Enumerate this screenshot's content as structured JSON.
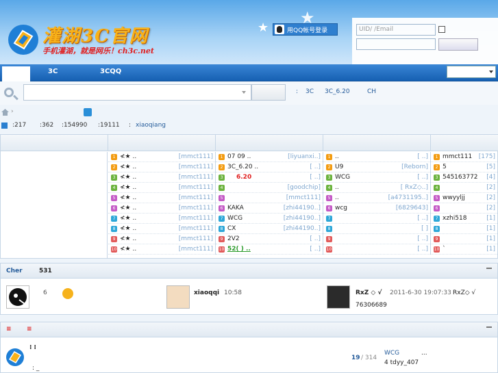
{
  "header": {
    "brand": "灌湖3C官网",
    "slogan": "手机灌湖，就是网乐！ch3c.net",
    "qq_login": "用QQ帐号登录",
    "uid_placeholder": "UID/  /Email",
    "colors": {
      "brand": "#f8b21a",
      "slogan": "#e02020",
      "sky": "#5aa8e8"
    }
  },
  "nav": {
    "items": [
      "3C",
      "3CQQ"
    ]
  },
  "search": {
    "hot": [
      ":",
      "3C",
      "3C_6.20",
      "CH"
    ]
  },
  "stats": {
    "items": [
      ":217",
      ":362",
      ":154990",
      ":19111",
      ":"
    ],
    "latest_member": "xiaoqiang"
  },
  "forum": {
    "col1": [
      {
        "n": "1",
        "t": "≮★",
        "dot": "..",
        "tag": "[mmct111]",
        "c": "#f39c12"
      },
      {
        "n": "2",
        "t": "≮★",
        "dot": "..",
        "tag": "[mmct111]",
        "c": "#f39c12"
      },
      {
        "n": "3",
        "t": "≮★",
        "dot": "..",
        "tag": "[mmct111]",
        "c": "#6cb33e"
      },
      {
        "n": "4",
        "t": "≮★",
        "dot": "..",
        "tag": "[mmct111]",
        "c": "#6cb33e"
      },
      {
        "n": "5",
        "t": "≮★",
        "dot": "..",
        "tag": "[mmct111]",
        "c": "#c45ac6"
      },
      {
        "n": "6",
        "t": "≮★",
        "dot": "..",
        "tag": "[mmct111]",
        "c": "#c45ac6"
      },
      {
        "n": "7",
        "t": "≮★",
        "dot": "..",
        "tag": "[mmct111]",
        "c": "#2ea7d8"
      },
      {
        "n": "8",
        "t": "≮★",
        "dot": "..",
        "tag": "[mmct111]",
        "c": "#2ea7d8"
      },
      {
        "n": "9",
        "t": "≮★",
        "dot": "..",
        "tag": "[mmct111]",
        "c": "#e25b5b"
      },
      {
        "n": "10",
        "t": "≮★",
        "dot": "..",
        "tag": "[mmct111]",
        "c": "#e25b5b"
      }
    ],
    "col2": [
      {
        "n": "1",
        "t": "07  09      ..",
        "tag": "[liyuanxi..]",
        "c": "#f39c12"
      },
      {
        "n": "2",
        "t": "3C_6.20      ..",
        "tag": "[  ..]",
        "c": "#f39c12"
      },
      {
        "n": "3",
        "t": "6.20",
        "tag": "[  ..]",
        "c": "#6cb33e",
        "red": true
      },
      {
        "n": "4",
        "t": "",
        "tag": "[goodchip]",
        "c": "#6cb33e"
      },
      {
        "n": "5",
        "t": "",
        "tag": "[mmct111]",
        "c": "#c45ac6"
      },
      {
        "n": "6",
        "t": "KAKA",
        "tag": "[zhi44190..]",
        "c": "#c45ac6"
      },
      {
        "n": "7",
        "t": "WCG",
        "tag": "[zhi44190..]",
        "c": "#2ea7d8"
      },
      {
        "n": "8",
        "t": "CX",
        "tag": "[zhi44190..]",
        "c": "#2ea7d8"
      },
      {
        "n": "9",
        "t": "2V2",
        "tag": "[  ..]",
        "c": "#e25b5b"
      },
      {
        "n": "10",
        "t": "52(    )       ..",
        "tag": "[  ..]",
        "c": "#e25b5b",
        "green": true
      }
    ],
    "col3": [
      {
        "n": "1",
        "t": "           ..",
        "tag": "[  ..]",
        "c": "#f39c12"
      },
      {
        "n": "2",
        "t": "U9",
        "tag": "[Reborn]",
        "c": "#f39c12"
      },
      {
        "n": "3",
        "t": "WCG",
        "tag": "[  ..]",
        "c": "#6cb33e"
      },
      {
        "n": "4",
        "t": "        ..",
        "tag": "[ RxZ◇..]",
        "c": "#6cb33e"
      },
      {
        "n": "5",
        "t": "        ..",
        "tag": "[a4731195..]",
        "c": "#c45ac6"
      },
      {
        "n": "6",
        "t": "wcg",
        "tag": "[6829643]",
        "c": "#c45ac6"
      },
      {
        "n": "7",
        "t": "",
        "tag": "[  ..]",
        "c": "#2ea7d8"
      },
      {
        "n": "8",
        "t": "",
        "tag": "[ ]",
        "c": "#2ea7d8"
      },
      {
        "n": "9",
        "t": "",
        "tag": "[  ..]",
        "c": "#e25b5b"
      },
      {
        "n": "10",
        "t": "",
        "tag": "[  ..]",
        "c": "#e25b5b"
      }
    ],
    "col4": [
      {
        "n": "1",
        "t": "mmct111",
        "tag": "[175]",
        "c": "#f39c12"
      },
      {
        "n": "2",
        "t": "5",
        "tag": "[5]",
        "c": "#f39c12"
      },
      {
        "n": "3",
        "t": "545163772",
        "tag": "[4]",
        "c": "#6cb33e"
      },
      {
        "n": "4",
        "t": "",
        "tag": "[2]",
        "c": "#6cb33e"
      },
      {
        "n": "5",
        "t": "wwyyljj",
        "tag": "[2]",
        "c": "#c45ac6"
      },
      {
        "n": "6",
        "t": "",
        "tag": "[2]",
        "c": "#c45ac6"
      },
      {
        "n": "7",
        "t": "xzhi518",
        "tag": "[1]",
        "c": "#2ea7d8"
      },
      {
        "n": "8",
        "t": "",
        "tag": "[1]",
        "c": "#2ea7d8"
      },
      {
        "n": "9",
        "t": "",
        "tag": "[1]",
        "c": "#e25b5b"
      },
      {
        "n": "10",
        "t": "`",
        "tag": "[1]",
        "c": "#e25b5b"
      }
    ]
  },
  "visitors": {
    "title": "Cher",
    "count": "531",
    "v1_num": "6",
    "v2_name": "xiaoqqi",
    "v2_time": "10:58",
    "v3_name": "RxZ ◇  √",
    "v3_date": "2011-6-30 19:07:33",
    "v3_extra": "RxZ◇ √",
    "v3_id": "76306689"
  },
  "bottom": {
    "tabs": [
      "≡",
      "≡"
    ],
    "marks": "⁞  ⁞",
    "sub": ": _",
    "pages": "19",
    "total": "/ 314",
    "wcg": "WCG",
    "dots": "...",
    "user_line": "4   tdyy_407"
  }
}
